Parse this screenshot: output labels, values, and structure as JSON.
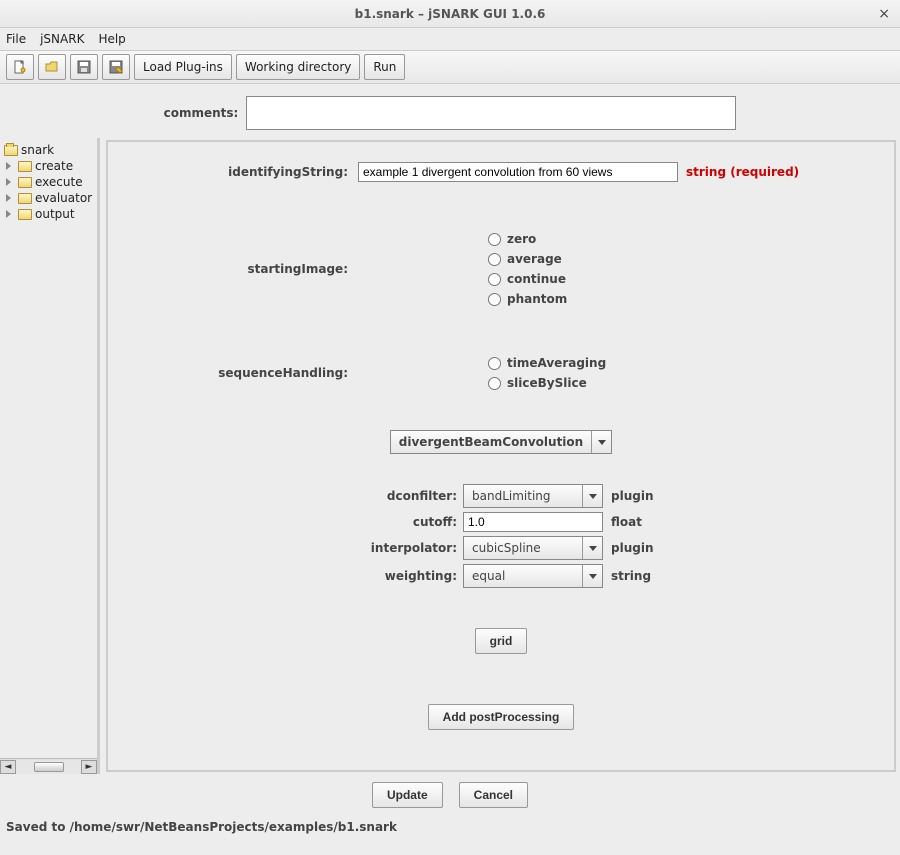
{
  "window": {
    "title": "b1.snark – jSNARK GUI 1.0.6"
  },
  "menu": {
    "file": "File",
    "jsnark": "jSNARK",
    "help": "Help"
  },
  "toolbar": {
    "load_plugins": "Load Plug-ins",
    "working_dir": "Working directory",
    "run": "Run"
  },
  "comments": {
    "label": "comments:",
    "value": ""
  },
  "tree": {
    "root": "snark",
    "items": [
      "create",
      "execute",
      "evaluator",
      "output"
    ]
  },
  "form": {
    "identifyingString": {
      "label": "identifyingString:",
      "value": "example 1 divergent convolution from 60 views",
      "req": "string (required)"
    },
    "startingImage": {
      "label": "startingImage:",
      "options": [
        "zero",
        "average",
        "continue",
        "phantom"
      ]
    },
    "sequenceHandling": {
      "label": "sequenceHandling:",
      "options": [
        "timeAveraging",
        "sliceBySlice"
      ]
    },
    "mainSelect": {
      "value": "divergentBeamConvolution"
    },
    "params": {
      "dconfilter": {
        "label": "dconfilter:",
        "value": "bandLimiting",
        "type": "plugin"
      },
      "cutoff": {
        "label": "cutoff:",
        "value": "1.0",
        "type": "float"
      },
      "interpolator": {
        "label": "interpolator:",
        "value": "cubicSpline",
        "type": "plugin"
      },
      "weighting": {
        "label": "weighting:",
        "value": "equal",
        "type": "string"
      }
    },
    "grid_btn": "grid",
    "add_post": "Add postProcessing"
  },
  "buttons": {
    "update": "Update",
    "cancel": "Cancel"
  },
  "status": "Saved to /home/swr/NetBeansProjects/examples/b1.snark"
}
